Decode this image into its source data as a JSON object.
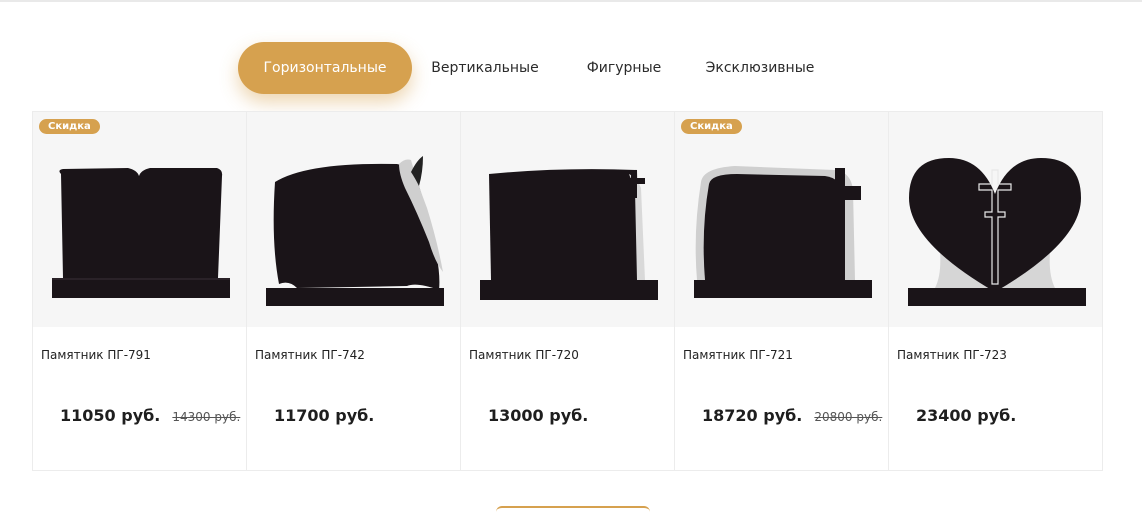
{
  "tabs": [
    {
      "label": "Горизонтальные",
      "active": true
    },
    {
      "label": "Вертикальные",
      "active": false
    },
    {
      "label": "Фигурные",
      "active": false
    },
    {
      "label": "Эксклюзивные",
      "active": false
    }
  ],
  "products": [
    {
      "badge": "Скидка",
      "title": "Памятник ПГ-791",
      "price": "11050 руб.",
      "old_price": "14300 руб.",
      "icon": "monument-book-image"
    },
    {
      "badge": "",
      "title": "Памятник ПГ-742",
      "price": "11700 руб.",
      "old_price": "",
      "icon": "monument-lily-image"
    },
    {
      "badge": "",
      "title": "Памятник ПГ-720",
      "price": "13000 руб.",
      "old_price": "",
      "icon": "monument-cross-image"
    },
    {
      "badge": "Скидка",
      "title": "Памятник ПГ-721",
      "price": "18720 руб.",
      "old_price": "20800 руб.",
      "icon": "monument-cross-frame-image"
    },
    {
      "badge": "",
      "title": "Памятник ПГ-723",
      "price": "23400 руб.",
      "old_price": "",
      "icon": "monument-heart-image"
    }
  ],
  "colors": {
    "accent": "#d6a14f",
    "granite": "#1a1418"
  }
}
